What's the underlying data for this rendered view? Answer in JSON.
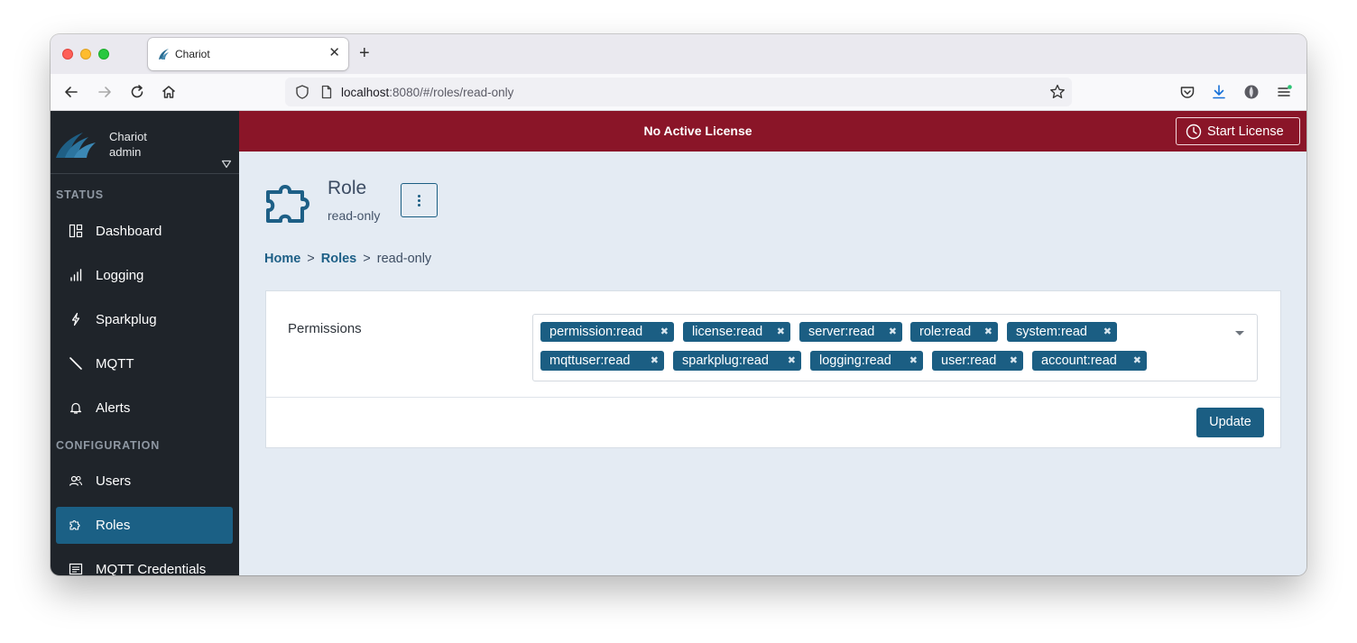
{
  "browser": {
    "tab_title": "Chariot",
    "url_host": "localhost",
    "url_path": ":8080/#/roles/read-only"
  },
  "sidebar": {
    "app_name": "Chariot",
    "user_name": "admin",
    "sections": {
      "status": "STATUS",
      "configuration": "CONFIGURATION"
    },
    "items": [
      {
        "label": "Dashboard",
        "icon": "dashboard-icon"
      },
      {
        "label": "Logging",
        "icon": "bar-chart-icon"
      },
      {
        "label": "Sparkplug",
        "icon": "lightning-icon"
      },
      {
        "label": "MQTT",
        "icon": "mqtt-icon"
      },
      {
        "label": "Alerts",
        "icon": "bell-icon"
      },
      {
        "label": "Users",
        "icon": "users-icon"
      },
      {
        "label": "Roles",
        "icon": "puzzle-icon",
        "active": true
      },
      {
        "label": "MQTT Credentials",
        "icon": "credentials-icon"
      }
    ]
  },
  "banner": {
    "text": "No Active License",
    "button_label": "Start License",
    "color": "#8a1528"
  },
  "page": {
    "title": "Role",
    "subtitle": "read-only",
    "breadcrumb": [
      "Home",
      "Roles",
      "read-only"
    ]
  },
  "form": {
    "permissions_label": "Permissions",
    "permissions": [
      "permission:read",
      "license:read",
      "server:read",
      "role:read",
      "system:read",
      "mqttuser:read",
      "sparkplug:read",
      "logging:read",
      "user:read",
      "account:read"
    ],
    "remove_glyph": "✖",
    "update_label": "Update"
  },
  "colors": {
    "accent": "#1b5e83",
    "sidebar_bg": "#1f242a",
    "main_bg": "#e4ebf3"
  }
}
